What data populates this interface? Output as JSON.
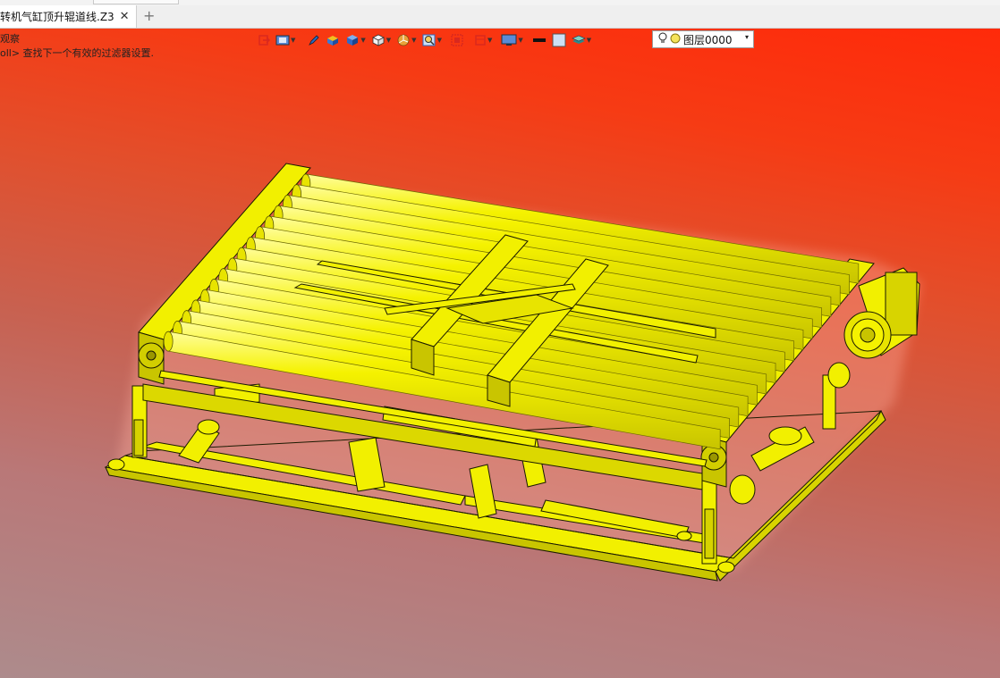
{
  "tab": {
    "title": "转机气缸顶升辊道线.Z3",
    "close_glyph": "✕",
    "add_glyph": "+"
  },
  "console": {
    "line1": "观察",
    "line2": "oll> 查找下一个有效的过滤器设置."
  },
  "toolbar": {
    "icons": [
      "exit-icon",
      "view-icon",
      "pen-icon",
      "shaded-box-icon",
      "solid-cube-icon",
      "wire-cube-icon",
      "pie-filter-icon",
      "zoom-icon",
      "box-select-icon",
      "frame-icon",
      "display-icon",
      "line-color-icon",
      "fill-color-icon",
      "layer-stack-icon"
    ],
    "colors": {
      "accent_blue": "#2b6cc4",
      "accent_red": "#d9281f",
      "accent_orange": "#e8a23a"
    }
  },
  "layer": {
    "label": "图层0000",
    "dropdown_glyph": "▾"
  },
  "colors": {
    "model_yellow": "#f2f000",
    "model_edge": "#1a1a00",
    "bg_top": "#ff2a0a",
    "bg_bottom": "#ad8b8c"
  }
}
